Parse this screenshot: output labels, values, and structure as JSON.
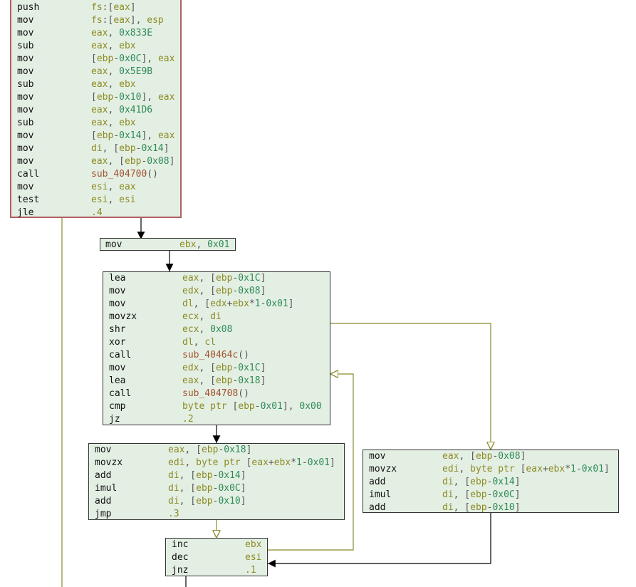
{
  "colors": {
    "block_bg": "#e4efe4",
    "block_border": "#333333",
    "entry_border": "#b06060",
    "edge_unconditional": "#000000",
    "edge_conditional": "#8a8a2a",
    "register": "#8b8b22",
    "number": "#2e8b57",
    "symbol": "#a0522d"
  },
  "blocks": [
    {
      "id": "block-entry",
      "instructions": [
        {
          "mnemonic": "push",
          "operands": "fs:[eax]"
        },
        {
          "mnemonic": "mov",
          "operands": "fs:[eax], esp"
        },
        {
          "mnemonic": "mov",
          "operands": "eax, 0x833E"
        },
        {
          "mnemonic": "sub",
          "operands": "eax, ebx"
        },
        {
          "mnemonic": "mov",
          "operands": "[ebp-0x0C], eax"
        },
        {
          "mnemonic": "mov",
          "operands": "eax, 0x5E9B"
        },
        {
          "mnemonic": "sub",
          "operands": "eax, ebx"
        },
        {
          "mnemonic": "mov",
          "operands": "[ebp-0x10], eax"
        },
        {
          "mnemonic": "mov",
          "operands": "eax, 0x41D6"
        },
        {
          "mnemonic": "sub",
          "operands": "eax, ebx"
        },
        {
          "mnemonic": "mov",
          "operands": "[ebp-0x14], eax"
        },
        {
          "mnemonic": "mov",
          "operands": "di, [ebp-0x14]"
        },
        {
          "mnemonic": "mov",
          "operands": "eax, [ebp-0x08]"
        },
        {
          "mnemonic": "call",
          "operands": "sub_404700()"
        },
        {
          "mnemonic": "mov",
          "operands": "esi, eax"
        },
        {
          "mnemonic": "test",
          "operands": "esi, esi"
        },
        {
          "mnemonic": "jle",
          "operands": ".4"
        }
      ]
    },
    {
      "id": "block-init",
      "instructions": [
        {
          "mnemonic": "mov",
          "operands": "ebx, 0x01"
        }
      ]
    },
    {
      "id": "block-loop",
      "instructions": [
        {
          "mnemonic": "lea",
          "operands": "eax, [ebp-0x1C]"
        },
        {
          "mnemonic": "mov",
          "operands": "edx, [ebp-0x08]"
        },
        {
          "mnemonic": "mov",
          "operands": "dl, [edx+ebx*1-0x01]"
        },
        {
          "mnemonic": "movzx",
          "operands": "ecx, di"
        },
        {
          "mnemonic": "shr",
          "operands": "ecx, 0x08"
        },
        {
          "mnemonic": "xor",
          "operands": "dl, cl"
        },
        {
          "mnemonic": "call",
          "operands": "sub_40464c()"
        },
        {
          "mnemonic": "mov",
          "operands": "edx, [ebp-0x1C]"
        },
        {
          "mnemonic": "lea",
          "operands": "eax, [ebp-0x18]"
        },
        {
          "mnemonic": "call",
          "operands": "sub_404708()"
        },
        {
          "mnemonic": "cmp",
          "operands": "byte ptr [ebp-0x01], 0x00"
        },
        {
          "mnemonic": "jz",
          "operands": ".2"
        }
      ]
    },
    {
      "id": "block-left",
      "instructions": [
        {
          "mnemonic": "mov",
          "operands": "eax, [ebp-0x18]"
        },
        {
          "mnemonic": "movzx",
          "operands": "edi, byte ptr [eax+ebx*1-0x01]"
        },
        {
          "mnemonic": "add",
          "operands": "di, [ebp-0x14]"
        },
        {
          "mnemonic": "imul",
          "operands": "di, [ebp-0x0C]"
        },
        {
          "mnemonic": "add",
          "operands": "di, [ebp-0x10]"
        },
        {
          "mnemonic": "jmp",
          "operands": ".3"
        }
      ]
    },
    {
      "id": "block-right",
      "instructions": [
        {
          "mnemonic": "mov",
          "operands": "eax, [ebp-0x08]"
        },
        {
          "mnemonic": "movzx",
          "operands": "edi, byte ptr [eax+ebx*1-0x01]"
        },
        {
          "mnemonic": "add",
          "operands": "di, [ebp-0x14]"
        },
        {
          "mnemonic": "imul",
          "operands": "di, [ebp-0x0C]"
        },
        {
          "mnemonic": "add",
          "operands": "di, [ebp-0x10]"
        }
      ]
    },
    {
      "id": "block-tail",
      "instructions": [
        {
          "mnemonic": "inc",
          "operands": "ebx"
        },
        {
          "mnemonic": "dec",
          "operands": "esi"
        },
        {
          "mnemonic": "jnz",
          "operands": ".1"
        }
      ]
    }
  ],
  "edges": [
    {
      "from": "block-entry",
      "to": "block-init",
      "kind": "unconditional"
    },
    {
      "from": "block-entry",
      "to": ".4",
      "kind": "conditional"
    },
    {
      "from": "block-init",
      "to": "block-loop",
      "kind": "unconditional"
    },
    {
      "from": "block-loop",
      "to": "block-left",
      "kind": "unconditional"
    },
    {
      "from": "block-loop",
      "to": "block-right",
      "kind": "conditional"
    },
    {
      "from": "block-left",
      "to": "block-tail",
      "kind": "conditional"
    },
    {
      "from": "block-right",
      "to": "block-tail",
      "kind": "unconditional"
    },
    {
      "from": "block-tail",
      "to": "block-loop",
      "kind": "conditional"
    }
  ]
}
